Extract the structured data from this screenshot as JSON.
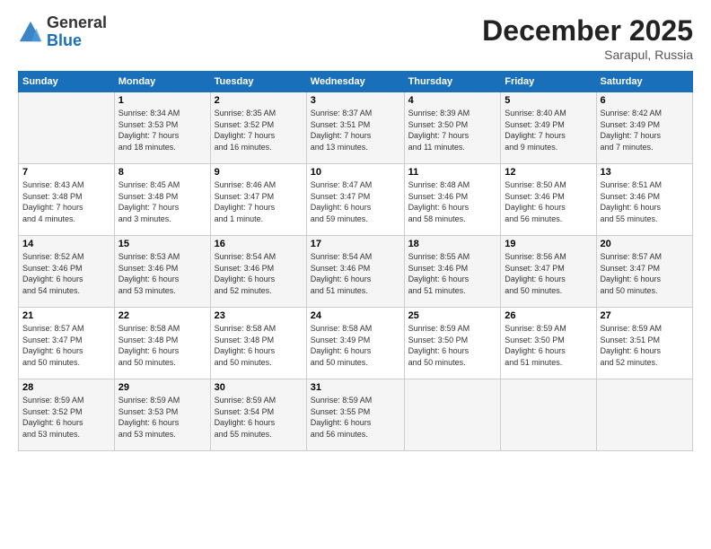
{
  "logo": {
    "general": "General",
    "blue": "Blue"
  },
  "header": {
    "month": "December 2025",
    "location": "Sarapul, Russia"
  },
  "days_of_week": [
    "Sunday",
    "Monday",
    "Tuesday",
    "Wednesday",
    "Thursday",
    "Friday",
    "Saturday"
  ],
  "weeks": [
    [
      {
        "day": "",
        "info": ""
      },
      {
        "day": "1",
        "info": "Sunrise: 8:34 AM\nSunset: 3:53 PM\nDaylight: 7 hours\nand 18 minutes."
      },
      {
        "day": "2",
        "info": "Sunrise: 8:35 AM\nSunset: 3:52 PM\nDaylight: 7 hours\nand 16 minutes."
      },
      {
        "day": "3",
        "info": "Sunrise: 8:37 AM\nSunset: 3:51 PM\nDaylight: 7 hours\nand 13 minutes."
      },
      {
        "day": "4",
        "info": "Sunrise: 8:39 AM\nSunset: 3:50 PM\nDaylight: 7 hours\nand 11 minutes."
      },
      {
        "day": "5",
        "info": "Sunrise: 8:40 AM\nSunset: 3:49 PM\nDaylight: 7 hours\nand 9 minutes."
      },
      {
        "day": "6",
        "info": "Sunrise: 8:42 AM\nSunset: 3:49 PM\nDaylight: 7 hours\nand 7 minutes."
      }
    ],
    [
      {
        "day": "7",
        "info": "Sunrise: 8:43 AM\nSunset: 3:48 PM\nDaylight: 7 hours\nand 4 minutes."
      },
      {
        "day": "8",
        "info": "Sunrise: 8:45 AM\nSunset: 3:48 PM\nDaylight: 7 hours\nand 3 minutes."
      },
      {
        "day": "9",
        "info": "Sunrise: 8:46 AM\nSunset: 3:47 PM\nDaylight: 7 hours\nand 1 minute."
      },
      {
        "day": "10",
        "info": "Sunrise: 8:47 AM\nSunset: 3:47 PM\nDaylight: 6 hours\nand 59 minutes."
      },
      {
        "day": "11",
        "info": "Sunrise: 8:48 AM\nSunset: 3:46 PM\nDaylight: 6 hours\nand 58 minutes."
      },
      {
        "day": "12",
        "info": "Sunrise: 8:50 AM\nSunset: 3:46 PM\nDaylight: 6 hours\nand 56 minutes."
      },
      {
        "day": "13",
        "info": "Sunrise: 8:51 AM\nSunset: 3:46 PM\nDaylight: 6 hours\nand 55 minutes."
      }
    ],
    [
      {
        "day": "14",
        "info": "Sunrise: 8:52 AM\nSunset: 3:46 PM\nDaylight: 6 hours\nand 54 minutes."
      },
      {
        "day": "15",
        "info": "Sunrise: 8:53 AM\nSunset: 3:46 PM\nDaylight: 6 hours\nand 53 minutes."
      },
      {
        "day": "16",
        "info": "Sunrise: 8:54 AM\nSunset: 3:46 PM\nDaylight: 6 hours\nand 52 minutes."
      },
      {
        "day": "17",
        "info": "Sunrise: 8:54 AM\nSunset: 3:46 PM\nDaylight: 6 hours\nand 51 minutes."
      },
      {
        "day": "18",
        "info": "Sunrise: 8:55 AM\nSunset: 3:46 PM\nDaylight: 6 hours\nand 51 minutes."
      },
      {
        "day": "19",
        "info": "Sunrise: 8:56 AM\nSunset: 3:47 PM\nDaylight: 6 hours\nand 50 minutes."
      },
      {
        "day": "20",
        "info": "Sunrise: 8:57 AM\nSunset: 3:47 PM\nDaylight: 6 hours\nand 50 minutes."
      }
    ],
    [
      {
        "day": "21",
        "info": "Sunrise: 8:57 AM\nSunset: 3:47 PM\nDaylight: 6 hours\nand 50 minutes."
      },
      {
        "day": "22",
        "info": "Sunrise: 8:58 AM\nSunset: 3:48 PM\nDaylight: 6 hours\nand 50 minutes."
      },
      {
        "day": "23",
        "info": "Sunrise: 8:58 AM\nSunset: 3:48 PM\nDaylight: 6 hours\nand 50 minutes."
      },
      {
        "day": "24",
        "info": "Sunrise: 8:58 AM\nSunset: 3:49 PM\nDaylight: 6 hours\nand 50 minutes."
      },
      {
        "day": "25",
        "info": "Sunrise: 8:59 AM\nSunset: 3:50 PM\nDaylight: 6 hours\nand 50 minutes."
      },
      {
        "day": "26",
        "info": "Sunrise: 8:59 AM\nSunset: 3:50 PM\nDaylight: 6 hours\nand 51 minutes."
      },
      {
        "day": "27",
        "info": "Sunrise: 8:59 AM\nSunset: 3:51 PM\nDaylight: 6 hours\nand 52 minutes."
      }
    ],
    [
      {
        "day": "28",
        "info": "Sunrise: 8:59 AM\nSunset: 3:52 PM\nDaylight: 6 hours\nand 53 minutes."
      },
      {
        "day": "29",
        "info": "Sunrise: 8:59 AM\nSunset: 3:53 PM\nDaylight: 6 hours\nand 53 minutes."
      },
      {
        "day": "30",
        "info": "Sunrise: 8:59 AM\nSunset: 3:54 PM\nDaylight: 6 hours\nand 55 minutes."
      },
      {
        "day": "31",
        "info": "Sunrise: 8:59 AM\nSunset: 3:55 PM\nDaylight: 6 hours\nand 56 minutes."
      },
      {
        "day": "",
        "info": ""
      },
      {
        "day": "",
        "info": ""
      },
      {
        "day": "",
        "info": ""
      }
    ]
  ]
}
